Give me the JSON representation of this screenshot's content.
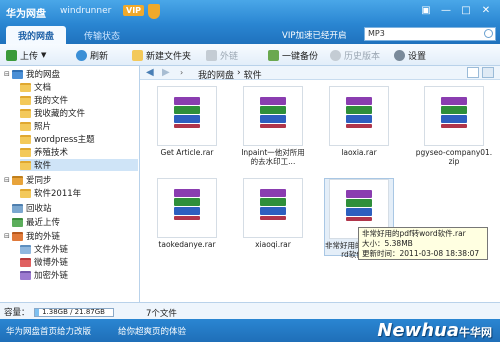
{
  "titlebar": {
    "app_title": "华为网盘",
    "username": "windrunner",
    "vip_badge": "VIP"
  },
  "tabs": [
    {
      "label": "我的网盘"
    },
    {
      "label": "传输状态"
    }
  ],
  "vip_notice": "VIP加速已经开启",
  "search": {
    "value": "MP3"
  },
  "toolbar": {
    "upload": "上传",
    "refresh": "刷新",
    "new_folder": "新建文件夹",
    "external_link": "外链",
    "one_click_backup": "一键备份",
    "history": "历史版本",
    "settings": "设置"
  },
  "breadcrumb": [
    "我的网盘",
    "软件"
  ],
  "sidebar": {
    "root": "我的网盘",
    "items": [
      {
        "label": "文档"
      },
      {
        "label": "我的文件"
      },
      {
        "label": "我收藏的文件"
      },
      {
        "label": "照片"
      },
      {
        "label": "wordpress主题"
      },
      {
        "label": "养殖技术"
      },
      {
        "label": "软件"
      }
    ],
    "sync": "爱同步",
    "sync_items": [
      {
        "label": "软件2011年"
      }
    ],
    "recycle": "回收站",
    "recent": "最近上传",
    "my_links": "我的外链",
    "link_items": [
      {
        "label": "文件外链"
      },
      {
        "label": "微博外链"
      },
      {
        "label": "加密外链"
      }
    ]
  },
  "files": [
    {
      "name": "Get Article.rar"
    },
    {
      "name": "Inpaint一他对所用的去水印工..."
    },
    {
      "name": "laoxia.rar"
    },
    {
      "name": "pgyseo-company01.zip"
    },
    {
      "name": "taokedanye.rar"
    },
    {
      "name": "xiaoqi.rar"
    },
    {
      "name": "非常好用的pdf转word软件.rar"
    }
  ],
  "tooltip": {
    "line1": "非常好用的pdf转word软件.rar",
    "line2": "大小：5.38MB",
    "line3": "更新时间：2011-03-08 18:38:07"
  },
  "status": {
    "capacity_label": "容量：",
    "capacity_value": "1.38GB / 21.87GB",
    "capacity_fraction": 0.063,
    "file_count": "7个文件"
  },
  "bottom": {
    "left_text": "华为网盘首页给力改版",
    "right_text": "给你超爽页的体验",
    "watermark": "Newhua",
    "watermark_cn": "牛华网"
  },
  "colors": {
    "accent": "#2a86d2",
    "folder": "#f3c95a",
    "tooltip_bg": "#ffffe1"
  }
}
